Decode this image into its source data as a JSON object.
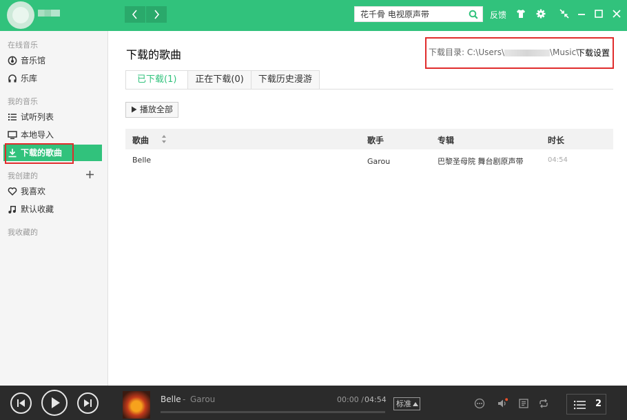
{
  "header": {
    "search_value": "花千骨 电视原声带",
    "feedback_label": "反馈"
  },
  "sidebar": {
    "group_online": "在线音乐",
    "online_items": [
      {
        "label": "音乐馆"
      },
      {
        "label": "乐库"
      }
    ],
    "group_my": "我的音乐",
    "my_items": [
      {
        "label": "试听列表"
      },
      {
        "label": "本地导入"
      },
      {
        "label": "下载的歌曲"
      }
    ],
    "group_created": "我创建的",
    "created_items": [
      {
        "label": "我喜欢"
      },
      {
        "label": "默认收藏"
      }
    ],
    "group_collected": "我收藏的"
  },
  "main": {
    "title": "下载的歌曲",
    "download_dir_label": "下载目录:",
    "download_dir_prefix": "C:\\Users\\",
    "download_dir_suffix": "\\Music\\",
    "download_settings": "下载设置",
    "tabs": [
      {
        "label": "已下载(1)"
      },
      {
        "label": "正在下载(0)"
      },
      {
        "label": "下载历史漫游"
      }
    ],
    "play_all_label": "播放全部",
    "columns": {
      "song": "歌曲",
      "artist": "歌手",
      "album": "专辑",
      "duration": "时长"
    },
    "rows": [
      {
        "song": "Belle",
        "artist": "Garou",
        "album": "巴黎圣母院 舞台剧原声带",
        "duration": "04:54"
      }
    ]
  },
  "player": {
    "song": "Belle",
    "separator": "-",
    "artist": "Garou",
    "time_current": "00:00",
    "time_sep": "/",
    "time_total": "04:54",
    "progress_fraction": 0,
    "quality_label": "标准",
    "playlist_count": "2"
  },
  "colors": {
    "brand": "#31c27c",
    "player_bg": "#2b2b2b",
    "highlight_box": "#e02b2b"
  }
}
